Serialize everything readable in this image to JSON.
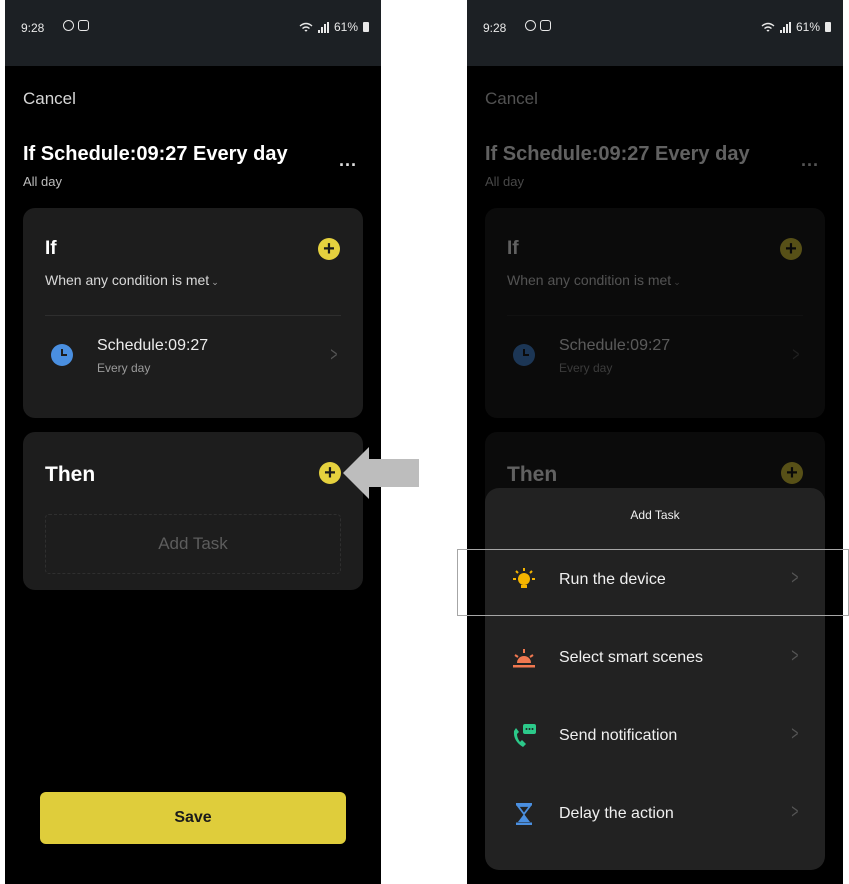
{
  "status_bar": {
    "time": "9:28",
    "battery": "61%"
  },
  "screen": {
    "cancel": "Cancel",
    "title": "If Schedule:09:27 Every day",
    "subtitle": "All day",
    "more": "...",
    "if_card": {
      "heading": "If",
      "condition": "When any condition is met",
      "schedule_title": "Schedule:09:27",
      "schedule_sub": "Every day"
    },
    "then_card": {
      "heading": "Then",
      "add_task": "Add Task"
    },
    "save": "Save"
  },
  "sheet": {
    "title": "Add Task",
    "options": [
      {
        "label": "Run the device",
        "icon": "bulb-icon"
      },
      {
        "label": "Select smart scenes",
        "icon": "sunrise-icon"
      },
      {
        "label": "Send notification",
        "icon": "phone-message-icon"
      },
      {
        "label": "Delay the action",
        "icon": "hourglass-icon"
      }
    ]
  },
  "colors": {
    "accent": "#e5d13e",
    "clock": "#4a8fe0",
    "bulb": "#f4b400",
    "sunrise": "#f07850",
    "notification": "#2cc98a",
    "hourglass": "#4a8fe0"
  }
}
